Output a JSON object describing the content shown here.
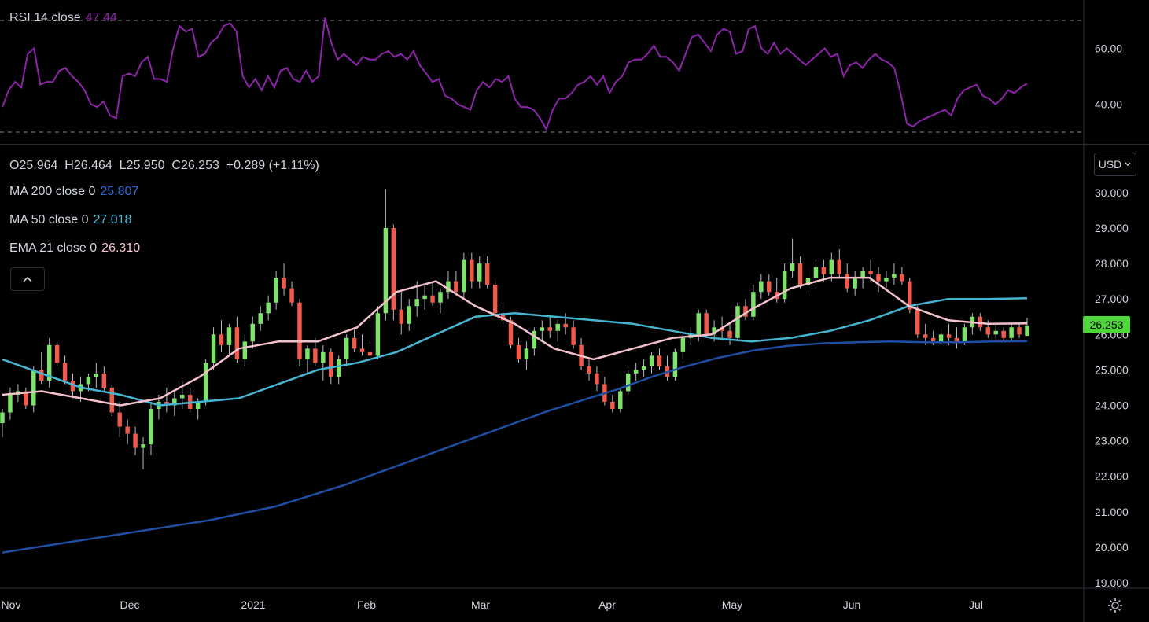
{
  "legend": {
    "rsi_label": "RSI 14 close",
    "rsi_value": "47.44",
    "ohlc": "O25.964  H26.464  L25.950  C26.253  +0.289 (+1.11%)",
    "ma200_label": "MA 200 close 0",
    "ma200_value": "25.807",
    "ma50_label": "MA 50 close 0",
    "ma50_value": "27.018",
    "ema21_label": "EMA 21 close 0",
    "ema21_value": "26.310"
  },
  "controls": {
    "currency": "USD",
    "collapse_icon": "chevron-up-icon",
    "settings_icon": "gear-icon"
  },
  "last_price": "26.253",
  "colors": {
    "up": "#7ee36a",
    "down": "#f05a4a",
    "rsi": "#8e24aa",
    "ma200": "#1f4ea3",
    "ma50": "#46b5d1",
    "ema21": "#f4c2cc",
    "last_price_bg": "#4fd63a"
  },
  "chart_data": [
    {
      "type": "line",
      "title": "RSI 14 close",
      "series": [
        {
          "name": "RSI 14 close",
          "values": [
            39,
            45,
            48,
            46,
            58,
            60,
            47,
            48,
            48,
            52,
            53,
            50,
            48,
            45,
            40,
            39,
            41,
            36,
            35,
            50,
            51,
            50,
            55,
            57,
            49,
            49,
            48,
            60,
            68,
            66,
            67,
            57,
            58,
            62,
            64,
            68,
            69,
            66,
            50,
            46,
            49,
            45,
            50,
            46,
            52,
            53,
            49,
            48,
            52,
            48,
            50,
            71,
            62,
            56,
            58,
            56,
            54,
            57,
            56,
            56,
            58,
            59,
            57,
            58,
            56,
            59,
            54,
            51,
            48,
            49,
            43,
            42,
            40,
            39,
            38,
            45,
            48,
            46,
            49,
            48,
            50,
            42,
            39,
            39,
            38,
            35,
            31,
            38,
            42,
            42,
            44,
            47,
            48,
            50,
            47,
            50,
            44,
            48,
            50,
            55,
            56,
            56,
            58,
            61,
            57,
            57,
            55,
            52,
            58,
            64,
            65,
            62,
            59,
            65,
            67,
            66,
            58,
            59,
            67,
            68,
            60,
            58,
            62,
            58,
            60,
            58,
            56,
            54,
            56,
            58,
            60,
            57,
            58,
            50,
            54,
            55,
            53,
            56,
            58,
            56,
            55,
            53,
            44,
            33,
            32,
            34,
            35,
            36,
            37,
            38,
            36,
            42,
            45,
            46,
            47,
            43,
            42,
            40,
            42,
            45,
            44,
            46,
            47.44
          ]
        }
      ],
      "yticks": [
        "60.00",
        "40.00"
      ],
      "ylim": [
        30,
        70
      ]
    },
    {
      "type": "candlestick",
      "x_labels": [
        "Nov",
        "Dec",
        "2021",
        "Feb",
        "Mar",
        "Apr",
        "May",
        "Jun",
        "Jul"
      ],
      "yticks": [
        "30.000",
        "29.000",
        "28.000",
        "27.000",
        "26.000",
        "25.000",
        "24.000",
        "23.000",
        "22.000",
        "21.000",
        "20.000",
        "19.000"
      ],
      "ylim": [
        18.9,
        30.5
      ],
      "candles": [
        [
          23.5,
          23.9,
          23.1,
          23.8
        ],
        [
          23.8,
          24.5,
          23.6,
          24.3
        ],
        [
          24.3,
          24.6,
          24.1,
          24.4
        ],
        [
          24.4,
          24.5,
          23.9,
          24.0
        ],
        [
          24.0,
          25.1,
          23.8,
          25.0
        ],
        [
          25.0,
          25.5,
          24.6,
          24.7
        ],
        [
          24.7,
          25.9,
          24.5,
          25.7
        ],
        [
          25.7,
          25.8,
          25.1,
          25.2
        ],
        [
          25.2,
          25.4,
          24.6,
          24.7
        ],
        [
          24.7,
          24.9,
          24.2,
          24.4
        ],
        [
          24.4,
          24.8,
          24.1,
          24.6
        ],
        [
          24.6,
          24.9,
          24.4,
          24.8
        ],
        [
          24.8,
          25.2,
          24.5,
          24.9
        ],
        [
          24.9,
          25.1,
          24.4,
          24.5
        ],
        [
          24.5,
          24.6,
          23.7,
          23.8
        ],
        [
          23.8,
          24.1,
          23.1,
          23.4
        ],
        [
          23.4,
          23.6,
          22.9,
          23.2
        ],
        [
          23.2,
          23.4,
          22.6,
          22.8
        ],
        [
          22.8,
          23.1,
          22.2,
          22.9
        ],
        [
          22.9,
          24.1,
          22.6,
          23.9
        ],
        [
          23.9,
          24.3,
          23.6,
          24.1
        ],
        [
          24.1,
          24.5,
          23.8,
          24.0
        ],
        [
          24.0,
          24.4,
          23.7,
          24.2
        ],
        [
          24.2,
          24.7,
          23.9,
          24.3
        ],
        [
          24.3,
          24.5,
          23.8,
          23.9
        ],
        [
          23.9,
          24.2,
          23.6,
          24.1
        ],
        [
          24.1,
          25.3,
          24.0,
          25.2
        ],
        [
          25.2,
          26.2,
          25.0,
          26.0
        ],
        [
          26.0,
          26.4,
          25.5,
          25.7
        ],
        [
          25.7,
          26.3,
          25.4,
          26.2
        ],
        [
          26.2,
          26.5,
          25.2,
          25.3
        ],
        [
          25.3,
          26.0,
          25.1,
          25.8
        ],
        [
          25.8,
          26.5,
          25.6,
          26.3
        ],
        [
          26.3,
          26.8,
          26.1,
          26.6
        ],
        [
          26.6,
          27.1,
          26.4,
          26.9
        ],
        [
          26.9,
          27.8,
          26.7,
          27.6
        ],
        [
          27.6,
          28.0,
          27.1,
          27.3
        ],
        [
          27.3,
          27.5,
          26.8,
          26.9
        ],
        [
          26.9,
          27.0,
          25.1,
          25.3
        ],
        [
          25.3,
          25.7,
          24.9,
          25.6
        ],
        [
          25.6,
          25.9,
          25.1,
          25.2
        ],
        [
          25.2,
          25.7,
          24.7,
          25.5
        ],
        [
          25.5,
          25.6,
          24.6,
          24.8
        ],
        [
          24.8,
          25.4,
          24.6,
          25.3
        ],
        [
          25.3,
          26.0,
          25.1,
          25.9
        ],
        [
          25.9,
          26.2,
          25.5,
          25.6
        ],
        [
          25.6,
          26.0,
          25.4,
          25.5
        ],
        [
          25.5,
          25.7,
          25.2,
          25.4
        ],
        [
          25.4,
          26.8,
          25.3,
          26.6
        ],
        [
          26.6,
          30.1,
          26.4,
          29.0
        ],
        [
          29.0,
          29.1,
          26.4,
          26.7
        ],
        [
          26.7,
          27.2,
          26.0,
          26.3
        ],
        [
          26.3,
          27.0,
          26.1,
          26.8
        ],
        [
          26.8,
          27.5,
          26.5,
          27.0
        ],
        [
          27.0,
          27.4,
          26.7,
          27.1
        ],
        [
          27.1,
          27.5,
          26.8,
          26.9
        ],
        [
          26.9,
          27.3,
          26.6,
          27.2
        ],
        [
          27.2,
          27.8,
          27.0,
          27.5
        ],
        [
          27.5,
          27.8,
          27.1,
          27.2
        ],
        [
          27.2,
          28.3,
          27.0,
          28.1
        ],
        [
          28.1,
          28.3,
          27.3,
          27.5
        ],
        [
          27.5,
          28.2,
          27.3,
          28.0
        ],
        [
          28.0,
          28.2,
          27.3,
          27.4
        ],
        [
          27.4,
          27.5,
          26.5,
          26.6
        ],
        [
          26.6,
          26.9,
          26.3,
          26.4
        ],
        [
          26.4,
          26.5,
          25.6,
          25.7
        ],
        [
          25.7,
          25.9,
          25.2,
          25.3
        ],
        [
          25.3,
          25.8,
          25.0,
          25.6
        ],
        [
          25.6,
          26.2,
          25.4,
          26.1
        ],
        [
          26.1,
          26.4,
          25.8,
          26.2
        ],
        [
          26.2,
          26.5,
          25.9,
          26.1
        ],
        [
          26.1,
          26.4,
          25.8,
          26.3
        ],
        [
          26.3,
          26.6,
          26.0,
          26.2
        ],
        [
          26.2,
          26.4,
          25.6,
          25.7
        ],
        [
          25.7,
          25.9,
          25.0,
          25.1
        ],
        [
          25.1,
          25.3,
          24.7,
          24.9
        ],
        [
          24.9,
          25.1,
          24.4,
          24.6
        ],
        [
          24.6,
          24.8,
          24.0,
          24.1
        ],
        [
          24.1,
          24.3,
          23.8,
          23.9
        ],
        [
          23.9,
          24.5,
          23.8,
          24.4
        ],
        [
          24.4,
          25.0,
          24.3,
          24.9
        ],
        [
          24.9,
          25.2,
          24.7,
          25.0
        ],
        [
          25.0,
          25.3,
          24.8,
          25.1
        ],
        [
          25.1,
          25.5,
          24.9,
          25.4
        ],
        [
          25.4,
          25.6,
          25.0,
          25.1
        ],
        [
          25.1,
          25.4,
          24.7,
          24.8
        ],
        [
          24.8,
          25.6,
          24.7,
          25.5
        ],
        [
          25.5,
          26.0,
          25.3,
          25.9
        ],
        [
          25.9,
          26.2,
          25.7,
          26.0
        ],
        [
          26.0,
          26.7,
          25.8,
          26.6
        ],
        [
          26.6,
          26.7,
          25.9,
          26.0
        ],
        [
          26.0,
          26.4,
          25.8,
          26.2
        ],
        [
          26.2,
          26.5,
          25.9,
          26.1
        ],
        [
          26.1,
          26.3,
          25.7,
          25.9
        ],
        [
          25.9,
          26.9,
          25.8,
          26.8
        ],
        [
          26.8,
          27.0,
          26.4,
          26.5
        ],
        [
          26.5,
          27.4,
          26.4,
          27.2
        ],
        [
          27.2,
          27.7,
          27.0,
          27.5
        ],
        [
          27.5,
          27.7,
          27.1,
          27.2
        ],
        [
          27.2,
          27.6,
          26.9,
          27.0
        ],
        [
          27.0,
          28.0,
          26.9,
          27.8
        ],
        [
          27.8,
          28.7,
          27.6,
          28.0
        ],
        [
          28.0,
          28.2,
          27.3,
          27.4
        ],
        [
          27.4,
          27.8,
          27.2,
          27.6
        ],
        [
          27.6,
          28.0,
          27.3,
          27.9
        ],
        [
          27.9,
          28.1,
          27.5,
          27.7
        ],
        [
          27.7,
          28.3,
          27.5,
          28.1
        ],
        [
          28.1,
          28.4,
          27.6,
          27.7
        ],
        [
          27.7,
          28.0,
          27.2,
          27.3
        ],
        [
          27.3,
          27.8,
          27.1,
          27.6
        ],
        [
          27.6,
          27.9,
          27.3,
          27.8
        ],
        [
          27.8,
          28.1,
          27.5,
          27.7
        ],
        [
          27.7,
          27.9,
          27.2,
          27.5
        ],
        [
          27.5,
          27.8,
          27.3,
          27.6
        ],
        [
          27.6,
          28.0,
          27.4,
          27.7
        ],
        [
          27.7,
          27.9,
          27.4,
          27.5
        ],
        [
          27.5,
          27.6,
          26.6,
          26.7
        ],
        [
          26.7,
          26.8,
          25.9,
          26.0
        ],
        [
          26.0,
          26.3,
          25.7,
          25.9
        ],
        [
          25.9,
          26.1,
          25.7,
          25.8
        ],
        [
          25.8,
          26.2,
          25.7,
          26.0
        ],
        [
          26.0,
          26.3,
          25.7,
          25.9
        ],
        [
          25.9,
          26.2,
          25.6,
          25.8
        ],
        [
          25.8,
          26.3,
          25.7,
          26.2
        ],
        [
          26.2,
          26.6,
          26.0,
          26.5
        ],
        [
          26.5,
          26.6,
          26.1,
          26.2
        ],
        [
          26.2,
          26.4,
          25.9,
          26.0
        ],
        [
          26.0,
          26.3,
          25.9,
          26.1
        ],
        [
          26.1,
          26.2,
          25.8,
          25.9
        ],
        [
          25.9,
          26.3,
          25.8,
          26.2
        ],
        [
          26.2,
          26.3,
          25.9,
          26.0
        ],
        [
          25.964,
          26.464,
          25.95,
          26.253
        ]
      ],
      "series": [
        {
          "name": "MA 200 close 0",
          "values": [
            19.85,
            20.0,
            20.15,
            20.3,
            20.45,
            20.6,
            20.75,
            20.95,
            21.15,
            21.45,
            21.75,
            22.1,
            22.45,
            22.8,
            23.15,
            23.5,
            23.85,
            24.15,
            24.45,
            24.8,
            25.1,
            25.35,
            25.55,
            25.68,
            25.75,
            25.78,
            25.8,
            25.78,
            25.78,
            25.8,
            25.81
          ]
        },
        {
          "name": "MA 50 close 0",
          "values": [
            25.3,
            24.9,
            24.5,
            24.3,
            24.0,
            24.1,
            24.2,
            24.6,
            25.0,
            25.2,
            25.5,
            26.0,
            26.5,
            26.6,
            26.5,
            26.4,
            26.3,
            26.1,
            25.9,
            25.8,
            25.9,
            26.1,
            26.4,
            26.8,
            27.0,
            27.0,
            27.02
          ]
        },
        {
          "name": "EMA 21 close 0",
          "values": [
            24.3,
            24.4,
            24.2,
            24.0,
            24.2,
            24.8,
            25.6,
            25.8,
            25.8,
            26.2,
            27.2,
            27.5,
            26.8,
            26.3,
            25.6,
            25.3,
            25.6,
            25.9,
            26.0,
            26.7,
            27.3,
            27.6,
            27.6,
            26.8,
            26.4,
            26.3,
            26.31
          ]
        }
      ]
    }
  ]
}
